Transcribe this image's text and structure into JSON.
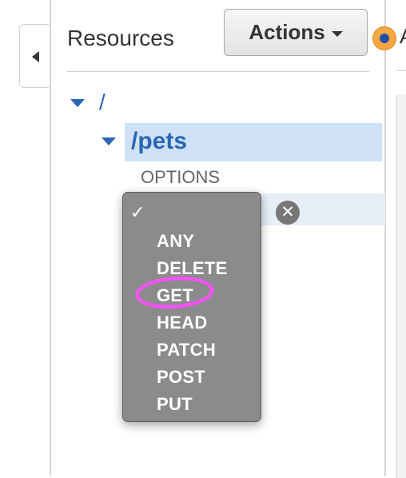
{
  "panel": {
    "title": "Resources",
    "actions_label": "Actions"
  },
  "header": {
    "right_truncated_text": "A"
  },
  "tree": {
    "root_path": "/",
    "child_path": "/pets",
    "methods": [
      "OPTIONS"
    ]
  },
  "method_select": {
    "selected_mark": "✓",
    "clear_glyph": "✕",
    "options": [
      "ANY",
      "DELETE",
      "GET",
      "HEAD",
      "PATCH",
      "POST",
      "PUT"
    ],
    "highlighted_option": "GET"
  },
  "icons": {
    "collapse": "caret-left-icon",
    "actions_dropdown": "caret-down-icon",
    "tree_expand": "caret-down-icon",
    "status": "status-dot-icon",
    "clear": "clear-icon",
    "check": "check-icon"
  },
  "colors": {
    "link_blue": "#2a66b3",
    "selected_row": "#cfe1f6",
    "dropdown_bg": "#8b8b8b",
    "annotation_magenta": "#ee55ee",
    "status_orange": "#f5a742"
  }
}
